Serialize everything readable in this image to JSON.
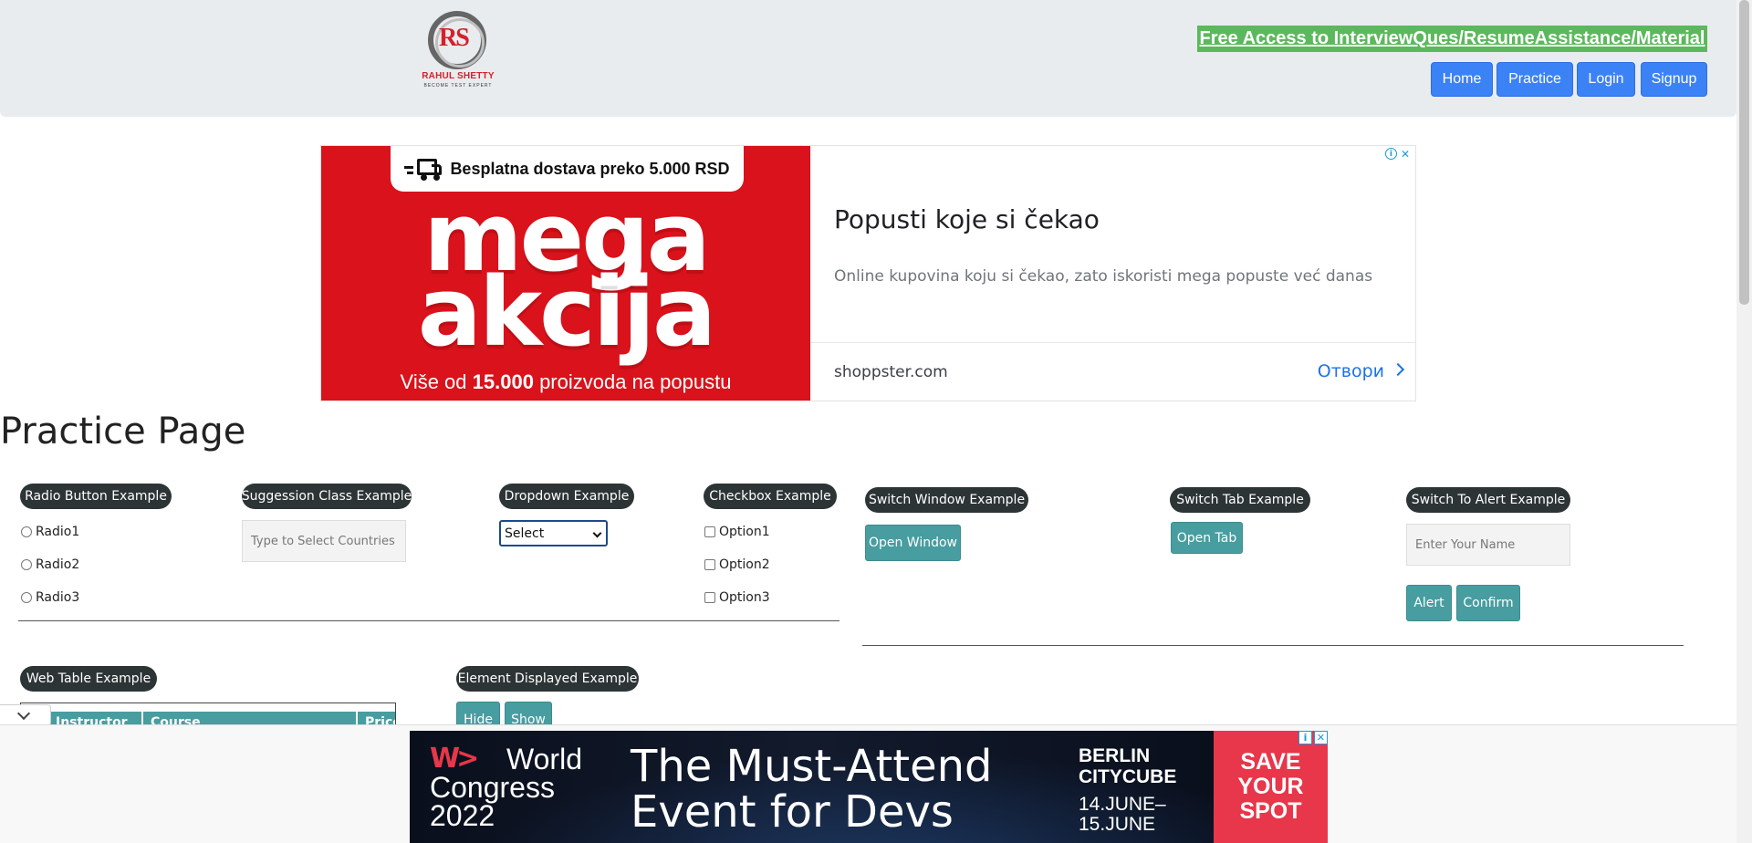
{
  "header": {
    "logo_name": "RAHUL SHETTY",
    "logo_tagline": "BECOME TEST EXPERT",
    "logo_monogram": "RS",
    "promo_link": "Free Access to InterviewQues/ResumeAssistance/Material",
    "nav": [
      "Home",
      "Practice",
      "Login",
      "Signup"
    ]
  },
  "ad_top": {
    "pill_text": "Besplatna dostava preko 5.000 RSD",
    "big_word_1": "mega",
    "big_word_2": "akcija",
    "sub_prefix": "Više od ",
    "sub_bold": "15.000",
    "sub_suffix": " proizvoda na popustu",
    "headline": "Popusti koje si čekao",
    "description": "Online kupovina koju si čekao, zato iskoristi mega popuste već danas",
    "domain": "shoppster.com",
    "open_label": "Отвори"
  },
  "page_title": "Practice Page",
  "radio_section": {
    "legend": "Radio Button Example",
    "options": [
      "Radio1",
      "Radio2",
      "Radio3"
    ]
  },
  "suggestion_section": {
    "legend": "Suggession Class Example",
    "placeholder": "Type to Select Countries"
  },
  "dropdown_section": {
    "legend": "Dropdown Example",
    "selected": "Select"
  },
  "checkbox_section": {
    "legend": "Checkbox Example",
    "options": [
      "Option1",
      "Option2",
      "Option3"
    ]
  },
  "switch_window": {
    "legend": "Switch Window Example",
    "button": "Open Window"
  },
  "switch_tab": {
    "legend": "Switch Tab Example",
    "button": "Open Tab"
  },
  "alert_section": {
    "legend": "Switch To Alert Example",
    "placeholder": "Enter Your Name",
    "alert_button": "Alert",
    "confirm_button": "Confirm"
  },
  "web_table": {
    "legend": "Web Table Example",
    "headers": [
      "Instructor",
      "Course",
      "Price"
    ]
  },
  "element_displayed": {
    "legend": "Element Displayed Example",
    "hide_button": "Hide",
    "show_button": "Show"
  },
  "ad_bottom": {
    "brand_line1": "World",
    "brand_line2": "Congress",
    "brand_line3": "2022",
    "headline_1": "The Must-Attend",
    "headline_2": "Event for Devs",
    "city_1": "BERLIN",
    "city_2": "CITYCUBE",
    "date_1": "14.JUNE–",
    "date_2": "15.JUNE",
    "cta_1": "SAVE",
    "cta_2": "YOUR",
    "cta_3": "SPOT"
  }
}
